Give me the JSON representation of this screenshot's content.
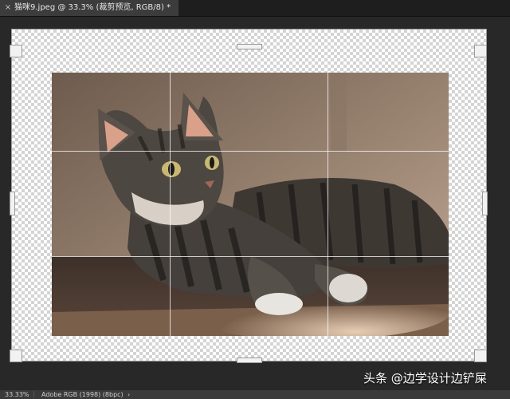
{
  "tab": {
    "title": "猫咪9.jpeg @ 33.3% (裁剪预览, RGB/8) *",
    "close_glyph": "×"
  },
  "status": {
    "zoom": "33.33%",
    "color_profile": "Adobe RGB (1998) (8bpc)",
    "arrow": "›"
  },
  "watermark": {
    "text": "头条 @边学设计边铲屎"
  },
  "photo": {
    "subject": "tabby kitten lying on rug looking up"
  }
}
